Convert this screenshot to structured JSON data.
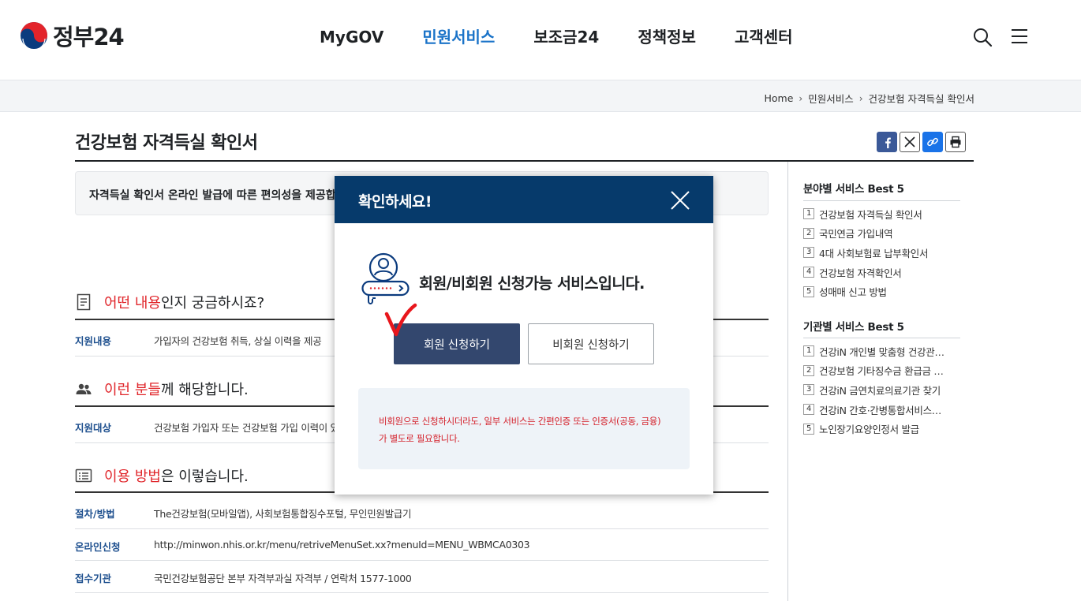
{
  "header": {
    "logo_text": "정부24",
    "nav": [
      "MyGOV",
      "민원서비스",
      "보조금24",
      "정책정보",
      "고객센터"
    ],
    "active_nav": "민원서비스",
    "search_icon": "search-icon",
    "menu_icon": "hamburger-menu-icon"
  },
  "breadcrumb": [
    "Home",
    "민원서비스",
    "건강보험 자격득실 확인서"
  ],
  "page": {
    "title": "건강보험 자격득실 확인서",
    "share": [
      "facebook",
      "x",
      "link",
      "print"
    ],
    "intro": "자격득실 확인서 온라인 발급에 따른 편의성을 제공합"
  },
  "sections": [
    {
      "icon": "document-icon",
      "heading_hl": "어떤 내용",
      "heading_rest": "인지 궁금하시죠?",
      "rows": [
        {
          "label": "지원내용",
          "value": "가입자의 건강보험 취득, 상실 이력을 제공"
        }
      ]
    },
    {
      "icon": "people-icon",
      "heading_hl": "이런 분들",
      "heading_rest": "께 해당합니다.",
      "rows": [
        {
          "label": "지원대상",
          "value": "건강보험 가입자 또는 건강보험 가입 이력이 있는"
        }
      ]
    },
    {
      "icon": "list-icon",
      "heading_hl": "이용 방법",
      "heading_rest": "은 이렇습니다.",
      "rows": [
        {
          "label": "절차/방법",
          "value": "The건강보험(모바일앱), 사회보험통합징수포털, 무인민원발급기"
        },
        {
          "label": "온라인신청",
          "value": "http://minwon.nhis.or.kr/menu/retriveMenuSet.xx?menuId=MENU_WBMCA0303"
        },
        {
          "label": "접수기관",
          "value": "국민건강보험공단 본부 자격부과실 자격부 / 연락처 1577-1000"
        }
      ]
    }
  ],
  "sidebar": {
    "field_title": "분야별 서비스 Best 5",
    "field_items": [
      "건강보험 자격득실 확인서",
      "국민연금 가입내역",
      "4대 사회보험료 납부확인서",
      "건강보험 자격확인서",
      "성매매 신고 방법"
    ],
    "agency_title": "기관별 서비스 Best 5",
    "agency_items": [
      "건강iN 개인별 맞춤형 건강관…",
      "건강보험 기타징수금 환급금 …",
      "건강iN 금연치료의료기관 찾기",
      "건강iN 간호·간병통합서비스…",
      "노인장기요양인정서 발급"
    ]
  },
  "modal": {
    "title": "확인하세요!",
    "message": "회원/비회원 신청가능 서비스입니다.",
    "member_button": "회원 신청하기",
    "guest_button": "비회원 신청하기",
    "notice_line1": "비회원으로 신청하시더라도, 일부 서비스는 간편인증 또는 인증서(공동, 금융)",
    "notice_line2": "가 별도로 필요합니다.",
    "close_icon": "close-icon"
  },
  "colors": {
    "brand_blue": "#063a6b",
    "active_nav": "#1a73c8",
    "highlight_red": "#e0252a",
    "member_button": "#33476e",
    "notice_red": "#d4202a"
  }
}
